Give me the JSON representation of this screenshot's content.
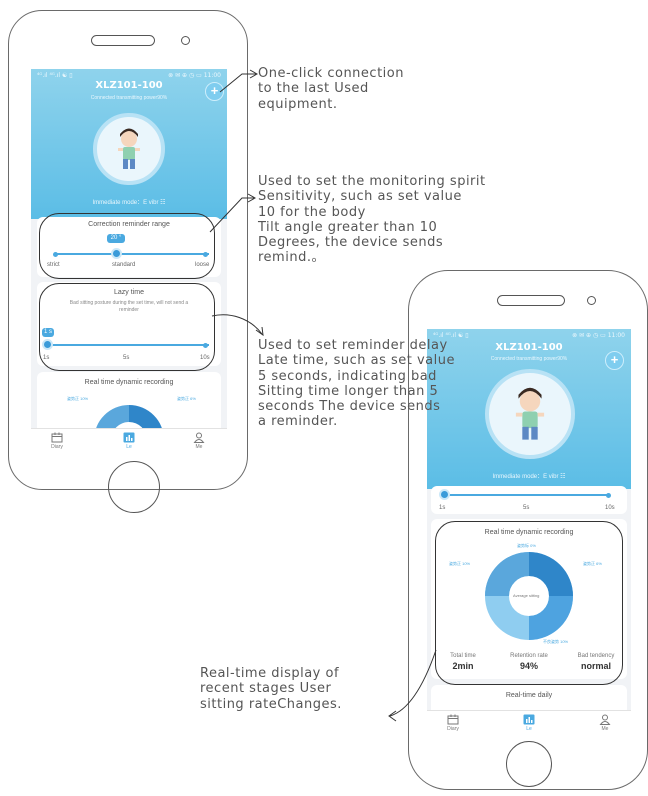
{
  "phone1": {
    "status_left": "⁴ᴳ.ıl ⁴ᴳ.ıl ☯ ▯",
    "status_right": "⊗ ✉ ⊕ ◷ ▭ 11:00",
    "device_name": "XLZ101-100",
    "connection_status": "Connected  transmitting power90%",
    "mode_text": "Immediate mode：E vibr ☷",
    "correction": {
      "title": "Correction reminder range",
      "tooltip": "20 °",
      "labels": [
        "strict",
        "standard",
        "loose"
      ]
    },
    "lazy": {
      "title": "Lazy time",
      "desc": "Bad sitting posture during the set time, will not send a reminder",
      "tooltip": "1 s",
      "labels": [
        "1s",
        "5s",
        "10s"
      ]
    },
    "recording": {
      "title": "Real time dynamic recording",
      "pct_left": "姿势正 10%",
      "pct_right": "姿势正 6%"
    },
    "tabs": {
      "diary": "Diary",
      "le": "Le",
      "me": "Me"
    }
  },
  "phone2": {
    "status_left": "⁴ᴳ.ıl ⁴ᴳ.ıl ☯ ▯",
    "status_right": "⊗ ✉ ⊕ ◷ ▭ 11:00",
    "device_name": "XLZ101-100",
    "connection_status": "Connected  transmitting power90%",
    "mode_text": "Immediate mode：E vibr ☷",
    "slider_labels": [
      "1s",
      "5s",
      "10s"
    ],
    "recording": {
      "title": "Real time dynamic recording",
      "pct_top": "姿势标 0%",
      "pct_left": "姿势正 10%",
      "pct_right": "姿势正 6%",
      "pct_bottom": "不良姿势 10%",
      "center": "Average sitting"
    },
    "stats": [
      {
        "label": "Total time",
        "value": "2min"
      },
      {
        "label": "Retention rate",
        "value": "94%"
      },
      {
        "label": "Bad tendency",
        "value": "normal"
      }
    ],
    "next_card_title": "Real-time daily",
    "tabs": {
      "diary": "Diary",
      "le": "Le",
      "me": "Me"
    }
  },
  "annotations": {
    "connection": [
      "One-click connection",
      "to the last Used",
      "equipment."
    ],
    "sensitivity": [
      "Used to set the monitoring spirit",
      "Sensitivity, such as set value",
      "10 for the body",
      "Tilt angle greater than 10",
      "Degrees, the device sends",
      "remind.。"
    ],
    "delay": [
      "Used to set reminder delay",
      "Late time, such as set value",
      "5 seconds, indicating bad",
      "Sitting time longer than 5",
      "seconds The device sends",
      "a reminder."
    ],
    "realtime": [
      "Real-time display of",
      "recent stages User",
      "sitting rateChanges."
    ]
  },
  "colors": {
    "header": "#5bbde6",
    "accent": "#4aa9e0",
    "donut_dark": "#2f86c9",
    "donut_light": "#8fcdf0"
  }
}
